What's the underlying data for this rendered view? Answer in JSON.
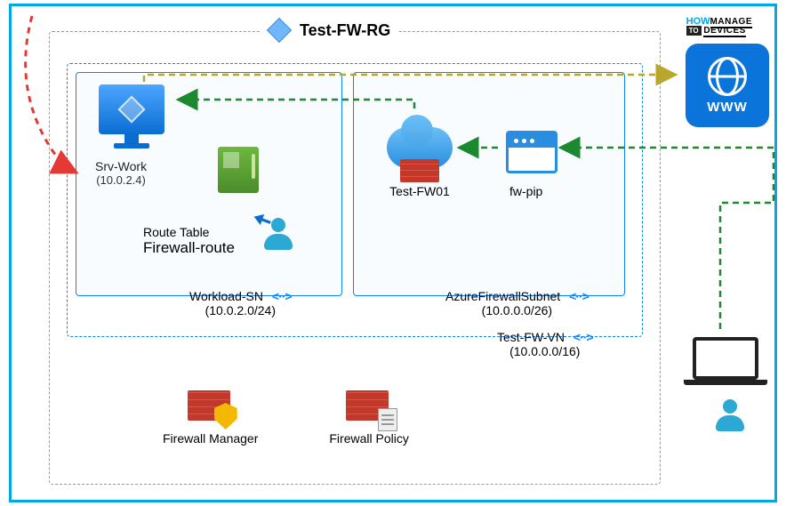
{
  "logo": {
    "how": "HOW",
    "to": "TO",
    "manage": "MANAGE",
    "devices": "DEVICES"
  },
  "resourceGroup": {
    "name": "Test-FW-RG"
  },
  "vnet": {
    "name": "Test-FW-VN",
    "cidr": "(10.0.0.0/16)"
  },
  "subnets": {
    "workload": {
      "name": "Workload-SN",
      "cidr": "(10.0.2.0/24)"
    },
    "firewall": {
      "name": "AzureFirewallSubnet",
      "cidr": "(10.0.0.0/26)"
    }
  },
  "vm": {
    "name": "Srv-Work",
    "ip": "(10.0.2.4)"
  },
  "routeTable": {
    "label": "Route Table",
    "name": "Firewall-route"
  },
  "firewall": {
    "name": "Test-FW01"
  },
  "pip": {
    "name": "fw-pip"
  },
  "internet": {
    "label": "WWW"
  },
  "bottomItems": {
    "manager": "Firewall Manager",
    "policy": "Firewall Policy"
  }
}
